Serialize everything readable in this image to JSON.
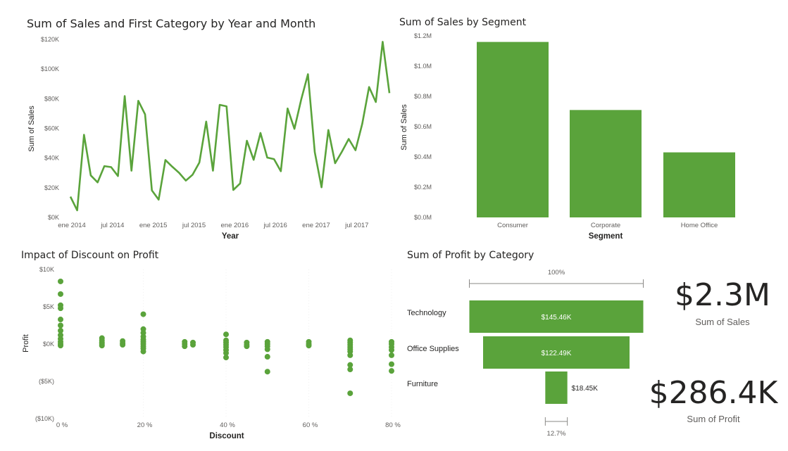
{
  "colors": {
    "accent": "#5aa33b",
    "text": "#252423",
    "muted": "#605e5c",
    "grid": "#e6e6e6"
  },
  "line_chart": {
    "title": "Sum of Sales and First Category by Year and Month",
    "xlabel": "Year",
    "ylabel": "Sum of Sales",
    "y_ticks": [
      "$0K",
      "$20K",
      "$40K",
      "$60K",
      "$80K",
      "$100K",
      "$120K"
    ],
    "x_ticks": [
      "ene 2014",
      "jul 2014",
      "ene 2015",
      "jul 2015",
      "ene 2016",
      "jul 2016",
      "ene 2017",
      "jul 2017"
    ]
  },
  "bar_chart": {
    "title": "Sum of Sales by Segment",
    "xlabel": "Segment",
    "ylabel": "Sum of Sales",
    "y_ticks": [
      "$0.0M",
      "$0.2M",
      "$0.4M",
      "$0.6M",
      "$0.8M",
      "$1.0M",
      "$1.2M"
    ]
  },
  "scatter_chart": {
    "title": "Impact of Discount on Profit",
    "xlabel": "Discount",
    "ylabel": "Profit",
    "y_ticks": [
      "$10K",
      "$5K",
      "$0K",
      "($5K)",
      "($10K)"
    ],
    "x_ticks": [
      "0 %",
      "20 %",
      "40 %",
      "60 %",
      "80 %"
    ]
  },
  "funnel_chart": {
    "title": "Sum of Profit by Category",
    "top_pct": "100%",
    "bottom_pct": "12.7%",
    "labels": [
      "Technology",
      "Office Supplies",
      "Furniture"
    ],
    "value_labels": [
      "$145.46K",
      "$122.49K",
      "$18.45K"
    ]
  },
  "kpis": [
    {
      "value": "$2.3M",
      "label": "Sum of Sales"
    },
    {
      "value": "$286.4K",
      "label": "Sum of Profit"
    }
  ],
  "chart_data": [
    {
      "type": "line",
      "title": "Sum of Sales and First Category by Year and Month",
      "xlabel": "Year",
      "ylabel": "Sum of Sales",
      "ylim": [
        0,
        120000
      ],
      "x": [
        "2014-01",
        "2014-02",
        "2014-03",
        "2014-04",
        "2014-05",
        "2014-06",
        "2014-07",
        "2014-08",
        "2014-09",
        "2014-10",
        "2014-11",
        "2014-12",
        "2015-01",
        "2015-02",
        "2015-03",
        "2015-04",
        "2015-05",
        "2015-06",
        "2015-07",
        "2015-08",
        "2015-09",
        "2015-10",
        "2015-11",
        "2015-12",
        "2016-01",
        "2016-02",
        "2016-03",
        "2016-04",
        "2016-05",
        "2016-06",
        "2016-07",
        "2016-08",
        "2016-09",
        "2016-10",
        "2016-11",
        "2016-12",
        "2017-01",
        "2017-02",
        "2017-03",
        "2017-04",
        "2017-05",
        "2017-06",
        "2017-07",
        "2017-08",
        "2017-09",
        "2017-10",
        "2017-11",
        "2017-12"
      ],
      "series": [
        {
          "values": [
            14000,
            4800,
            55700,
            28300,
            23600,
            34600,
            33900,
            27900,
            81800,
            31500,
            78600,
            69500,
            18200,
            12000,
            38700,
            34200,
            30100,
            24800,
            28800,
            37000,
            64600,
            31500,
            75900,
            74900,
            18500,
            22900,
            51700,
            38800,
            56900,
            40300,
            39300,
            31100,
            73400,
            59700,
            79400,
            96500,
            44000,
            20300,
            58900,
            36500,
            44300,
            52900,
            45300,
            63100,
            87900,
            77800,
            118400,
            83800
          ]
        }
      ]
    },
    {
      "type": "bar",
      "title": "Sum of Sales by Segment",
      "xlabel": "Segment",
      "ylabel": "Sum of Sales",
      "categories": [
        "Consumer",
        "Corporate",
        "Home Office"
      ],
      "values": [
        1160000,
        710000,
        430000
      ],
      "ylim": [
        0,
        1200000
      ]
    },
    {
      "type": "scatter",
      "title": "Impact of Discount on Profit",
      "xlabel": "Discount",
      "ylabel": "Profit",
      "xlim": [
        0,
        0.8
      ],
      "ylim": [
        -10000,
        10000
      ],
      "points": [
        [
          0,
          8400
        ],
        [
          0,
          6700
        ],
        [
          0,
          5200
        ],
        [
          0,
          4800
        ],
        [
          0,
          3300
        ],
        [
          0,
          2500
        ],
        [
          0,
          1800
        ],
        [
          0,
          1200
        ],
        [
          0,
          700
        ],
        [
          0,
          300
        ],
        [
          0,
          0
        ],
        [
          0,
          -200
        ],
        [
          0.1,
          800
        ],
        [
          0.1,
          500
        ],
        [
          0.1,
          200
        ],
        [
          0.1,
          0
        ],
        [
          0.1,
          -200
        ],
        [
          0.15,
          400
        ],
        [
          0.15,
          100
        ],
        [
          0.15,
          -100
        ],
        [
          0.2,
          4000
        ],
        [
          0.2,
          2000
        ],
        [
          0.2,
          1500
        ],
        [
          0.2,
          1000
        ],
        [
          0.2,
          600
        ],
        [
          0.2,
          300
        ],
        [
          0.2,
          0
        ],
        [
          0.2,
          -300
        ],
        [
          0.2,
          -600
        ],
        [
          0.2,
          -1000
        ],
        [
          0.3,
          300
        ],
        [
          0.3,
          0
        ],
        [
          0.3,
          -300
        ],
        [
          0.32,
          200
        ],
        [
          0.32,
          -100
        ],
        [
          0.4,
          1300
        ],
        [
          0.4,
          500
        ],
        [
          0.4,
          200
        ],
        [
          0.4,
          -100
        ],
        [
          0.4,
          -400
        ],
        [
          0.4,
          -800
        ],
        [
          0.4,
          -1200
        ],
        [
          0.4,
          -1800
        ],
        [
          0.45,
          200
        ],
        [
          0.45,
          -100
        ],
        [
          0.45,
          -300
        ],
        [
          0.5,
          300
        ],
        [
          0.5,
          0
        ],
        [
          0.5,
          -300
        ],
        [
          0.5,
          -700
        ],
        [
          0.5,
          -1700
        ],
        [
          0.5,
          -3700
        ],
        [
          0.6,
          300
        ],
        [
          0.6,
          0
        ],
        [
          0.6,
          -200
        ],
        [
          0.7,
          500
        ],
        [
          0.7,
          200
        ],
        [
          0.7,
          -100
        ],
        [
          0.7,
          -400
        ],
        [
          0.7,
          -700
        ],
        [
          0.7,
          -1000
        ],
        [
          0.7,
          -1500
        ],
        [
          0.7,
          -2800
        ],
        [
          0.7,
          -3400
        ],
        [
          0.7,
          -6600
        ],
        [
          0.8,
          300
        ],
        [
          0.8,
          0
        ],
        [
          0.8,
          -400
        ],
        [
          0.8,
          -800
        ],
        [
          0.8,
          -1500
        ],
        [
          0.8,
          -2700
        ],
        [
          0.8,
          -3600
        ]
      ]
    },
    {
      "type": "funnel",
      "title": "Sum of Profit by Category",
      "categories": [
        "Technology",
        "Office Supplies",
        "Furniture"
      ],
      "values": [
        145460,
        122490,
        18450
      ]
    }
  ]
}
